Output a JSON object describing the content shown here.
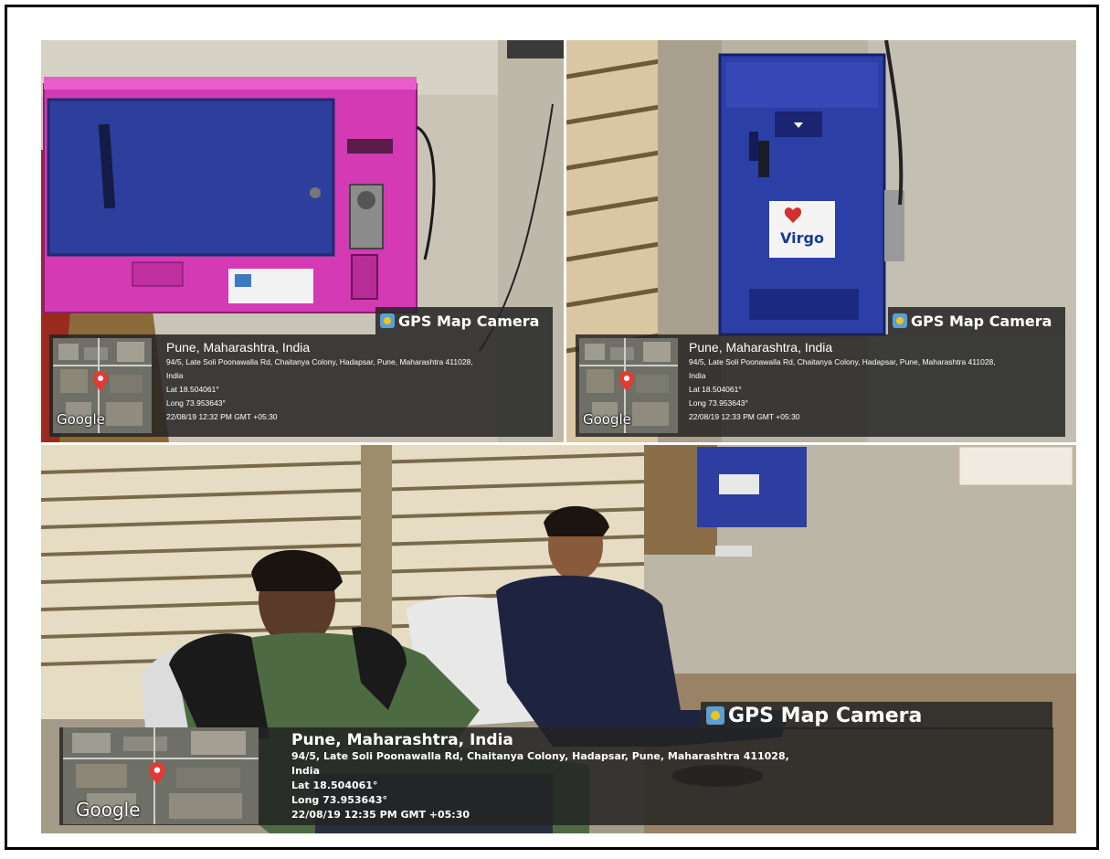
{
  "photos": [
    {
      "gps_tag": "GPS Map Camera",
      "map_provider": "Google",
      "city": "Pune, Maharashtra, India",
      "address_line1": "94/5, Late Soli Poonawalla Rd, Chaitanya Colony, Hadapsar, Pune, Maharashtra 411028,",
      "address_line2": "India",
      "lat": "Lat 18.504061°",
      "long": "Long 73.953643°",
      "datetime": "22/08/19 12:32 PM GMT +05:30",
      "icon": "map-pin-icon"
    },
    {
      "gps_tag": "GPS Map Camera",
      "map_provider": "Google",
      "city": "Pune, Maharashtra, India",
      "address_line1": "94/5, Late Soli Poonawalla Rd, Chaitanya Colony, Hadapsar, Pune, Maharashtra 411028,",
      "address_line2": "India",
      "lat": "Lat 18.504061°",
      "long": "Long 73.953643°",
      "datetime": "22/08/19 12:33 PM GMT +05:30",
      "brand_label": "Virgo",
      "icon": "map-pin-icon"
    },
    {
      "gps_tag": "GPS Map Camera",
      "map_provider": "Google",
      "city": "Pune, Maharashtra, India",
      "address_line1": "94/5, Late Soli Poonawalla Rd, Chaitanya Colony, Hadapsar, Pune, Maharashtra 411028,",
      "address_line2": "India",
      "lat": "Lat 18.504061°",
      "long": "Long 73.953643°",
      "datetime": "22/08/19 12:35 PM GMT +05:30",
      "icon": "map-pin-icon"
    }
  ],
  "colors": {
    "pink_machine": "#d43ab4",
    "blue_panel": "#2e3e9c",
    "blue_machine": "#2c3fa6",
    "overlay": "#282828",
    "pin": "#e53935"
  }
}
